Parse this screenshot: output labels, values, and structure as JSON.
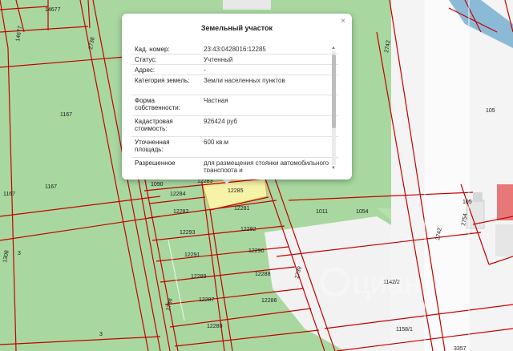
{
  "popup": {
    "title": "Земельный участок",
    "close": "×",
    "rows": [
      {
        "key": "Кад. номер:",
        "value": "23:43:0428016:12285"
      },
      {
        "key": "Статус:",
        "value": "Учтенный"
      },
      {
        "key": "Адрес:",
        "value": "-"
      },
      {
        "key": "Категория земель:",
        "value": "Земли населенных пунктов"
      },
      {
        "key": "Форма собственности:",
        "value": "Частная"
      },
      {
        "key": "Кадастровая стоимость:",
        "value": "926424 руб"
      },
      {
        "key": "Уточненная площадь:",
        "value": "600 кв.м"
      },
      {
        "key": "Разрешенное",
        "value": "для размещения стоянки автомобильного транспорта и"
      }
    ]
  },
  "map": {
    "parcel_labels": {
      "p14677": "14677",
      "p14677b": "14677",
      "p2738": "2738",
      "p2738b": "2738",
      "p2742": "2742",
      "p2742b": "2742",
      "p1167a": "1167",
      "p1167b": "1167",
      "p1167c": "1167",
      "p1308": "1308",
      "p3a": "3",
      "p3b": "3",
      "p105a": "105",
      "p105b": "105",
      "p2754": "2754",
      "p1090": "1090",
      "p12284": "12284",
      "p12283": "12283",
      "p12285": "12285",
      "p12282": "12282",
      "p12281": "12281",
      "p12293": "12293",
      "p12292": "12292",
      "p12291": "12291",
      "p12290": "12290",
      "p12289": "12289",
      "p12288": "12288",
      "p12287": "12287",
      "p12286": "12286",
      "p12280": "12280",
      "p2739": "2739",
      "p1011": "1011",
      "p1054": "1054",
      "p1142_2": "1142/2",
      "p1158_1": "1158/1",
      "p3357": "3357"
    },
    "watermark": "циан",
    "colors": {
      "green": "#a8d8a0",
      "light_green": "#b9e2b0",
      "boundary": "#c40000",
      "selected": "#f6f3a8",
      "road": "#f4f4f4"
    }
  }
}
